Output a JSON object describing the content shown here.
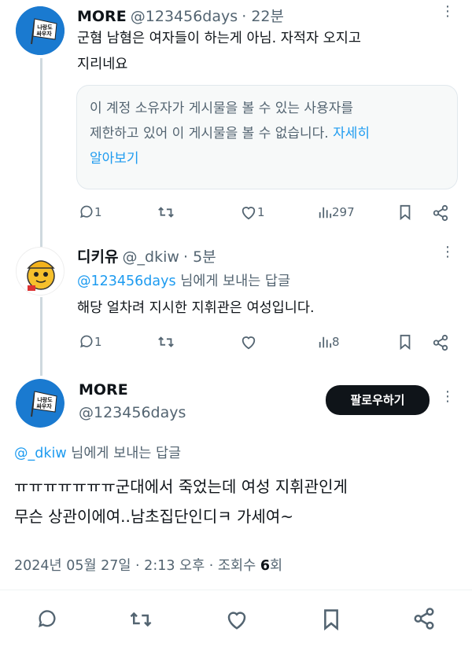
{
  "tweet1": {
    "display_name": "MORE",
    "handle": "@123456days",
    "time": "· 22분",
    "text_line1": "군혐 남혐은 여자들이 하는게 아님. 자적자 오지고",
    "text_line2": "지리네요",
    "notice_line1": "이 계정 소유자가 게시물을 볼 수 있는 사용자를",
    "notice_line2_prefix": "제한하고 있어 이 게시물을 볼 수 없습니다. ",
    "notice_link_1": "자세히",
    "notice_link_2": "알아보기",
    "reply_count": "1",
    "like_count": "1",
    "views": "297"
  },
  "tweet2": {
    "display_name": "디키유",
    "handle": "@_dkiw",
    "time": "· 5분",
    "reply_to_handle": "@123456days",
    "reply_to_suffix": " 님에게 보내는 답글",
    "text": "해당 얼차려 지시한 지휘관은 여성입니다.",
    "reply_count": "1",
    "views": "8"
  },
  "main_tweet": {
    "display_name": "MORE",
    "handle": "@123456days",
    "follow_label": "팔로우하기",
    "reply_to_handle": "@_dkiw",
    "reply_to_suffix": " 님에게 보내는 답글",
    "text_line1": "ㅠㅠㅠㅠㅠㅠㅠ군대에서 죽었는데 여성 지휘관인게",
    "text_line2": "무슨 상관이에여..남초집단인디ㅋ 가세여~",
    "date": "2024년 05월 27일 · 2:13 오후 · 조회수 ",
    "view_count": "6",
    "view_unit": "회"
  },
  "avatar_more_text": "나랑도 싸우자",
  "colors": {
    "accent": "#1d9bf0",
    "text": "#0f1419",
    "muted": "#536471"
  }
}
